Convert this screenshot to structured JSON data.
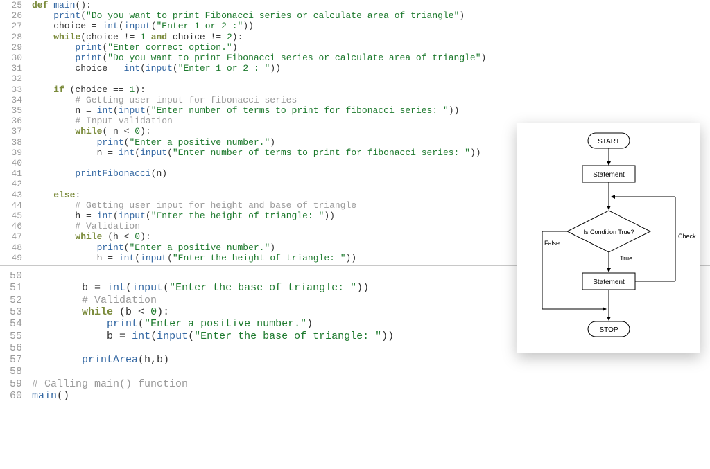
{
  "code": {
    "lines": [
      {
        "n": 25,
        "tokens": [
          [
            "kw",
            "def"
          ],
          [
            "norm",
            " "
          ],
          [
            "fn",
            "main"
          ],
          [
            "norm",
            "():"
          ]
        ]
      },
      {
        "n": 26,
        "tokens": [
          [
            "norm",
            "    "
          ],
          [
            "fn",
            "print"
          ],
          [
            "norm",
            "("
          ],
          [
            "str",
            "\"Do you want to print Fibonacci series or calculate area of triangle\""
          ],
          [
            "norm",
            ")"
          ]
        ]
      },
      {
        "n": 27,
        "tokens": [
          [
            "norm",
            "    choice "
          ],
          [
            "op",
            "="
          ],
          [
            "norm",
            " "
          ],
          [
            "fn",
            "int"
          ],
          [
            "norm",
            "("
          ],
          [
            "fn",
            "input"
          ],
          [
            "norm",
            "("
          ],
          [
            "str",
            "\"Enter 1 or 2 :\""
          ],
          [
            "norm",
            "))"
          ]
        ]
      },
      {
        "n": 28,
        "tokens": [
          [
            "norm",
            "    "
          ],
          [
            "kw",
            "while"
          ],
          [
            "norm",
            "(choice "
          ],
          [
            "op",
            "!="
          ],
          [
            "norm",
            " "
          ],
          [
            "num",
            "1"
          ],
          [
            "norm",
            " "
          ],
          [
            "kw",
            "and"
          ],
          [
            "norm",
            " choice "
          ],
          [
            "op",
            "!="
          ],
          [
            "norm",
            " "
          ],
          [
            "num",
            "2"
          ],
          [
            "norm",
            "):"
          ]
        ]
      },
      {
        "n": 29,
        "tokens": [
          [
            "norm",
            "        "
          ],
          [
            "fn",
            "print"
          ],
          [
            "norm",
            "("
          ],
          [
            "str",
            "\"Enter correct option.\""
          ],
          [
            "norm",
            ")"
          ]
        ]
      },
      {
        "n": 30,
        "tokens": [
          [
            "norm",
            "        "
          ],
          [
            "fn",
            "print"
          ],
          [
            "norm",
            "("
          ],
          [
            "str",
            "\"Do you want to print Fibonacci series or calculate area of triangle\""
          ],
          [
            "norm",
            ")"
          ]
        ]
      },
      {
        "n": 31,
        "tokens": [
          [
            "norm",
            "        choice "
          ],
          [
            "op",
            "="
          ],
          [
            "norm",
            " "
          ],
          [
            "fn",
            "int"
          ],
          [
            "norm",
            "("
          ],
          [
            "fn",
            "input"
          ],
          [
            "norm",
            "("
          ],
          [
            "str",
            "\"Enter 1 or 2 : \""
          ],
          [
            "norm",
            "))"
          ]
        ]
      },
      {
        "n": 32,
        "tokens": []
      },
      {
        "n": 33,
        "tokens": [
          [
            "norm",
            "    "
          ],
          [
            "kw",
            "if"
          ],
          [
            "norm",
            " (choice "
          ],
          [
            "op",
            "=="
          ],
          [
            "norm",
            " "
          ],
          [
            "num",
            "1"
          ],
          [
            "norm",
            "):"
          ]
        ]
      },
      {
        "n": 34,
        "tokens": [
          [
            "norm",
            "        "
          ],
          [
            "cmt",
            "# Getting user input for fibonacci series"
          ]
        ]
      },
      {
        "n": 35,
        "tokens": [
          [
            "norm",
            "        n "
          ],
          [
            "op",
            "="
          ],
          [
            "norm",
            " "
          ],
          [
            "fn",
            "int"
          ],
          [
            "norm",
            "("
          ],
          [
            "fn",
            "input"
          ],
          [
            "norm",
            "("
          ],
          [
            "str",
            "\"Enter number of terms to print for fibonacci series: \""
          ],
          [
            "norm",
            "))"
          ]
        ]
      },
      {
        "n": 36,
        "tokens": [
          [
            "norm",
            "        "
          ],
          [
            "cmt",
            "# Input validation"
          ]
        ]
      },
      {
        "n": 37,
        "tokens": [
          [
            "norm",
            "        "
          ],
          [
            "kw",
            "while"
          ],
          [
            "norm",
            "( n "
          ],
          [
            "op",
            "<"
          ],
          [
            "norm",
            " "
          ],
          [
            "num",
            "0"
          ],
          [
            "norm",
            "):"
          ]
        ]
      },
      {
        "n": 38,
        "tokens": [
          [
            "norm",
            "            "
          ],
          [
            "fn",
            "print"
          ],
          [
            "norm",
            "("
          ],
          [
            "str",
            "\"Enter a positive number.\""
          ],
          [
            "norm",
            ")"
          ]
        ]
      },
      {
        "n": 39,
        "tokens": [
          [
            "norm",
            "            n "
          ],
          [
            "op",
            "="
          ],
          [
            "norm",
            " "
          ],
          [
            "fn",
            "int"
          ],
          [
            "norm",
            "("
          ],
          [
            "fn",
            "input"
          ],
          [
            "norm",
            "("
          ],
          [
            "str",
            "\"Enter number of terms to print for fibonacci series: \""
          ],
          [
            "norm",
            "))"
          ]
        ]
      },
      {
        "n": 40,
        "tokens": []
      },
      {
        "n": 41,
        "tokens": [
          [
            "norm",
            "        "
          ],
          [
            "fn",
            "printFibonacci"
          ],
          [
            "norm",
            "(n)"
          ]
        ]
      },
      {
        "n": 42,
        "tokens": []
      },
      {
        "n": 43,
        "tokens": [
          [
            "norm",
            "    "
          ],
          [
            "kw",
            "else"
          ],
          [
            "norm",
            ":"
          ]
        ]
      },
      {
        "n": 44,
        "tokens": [
          [
            "norm",
            "        "
          ],
          [
            "cmt",
            "# Getting user input for height and base of triangle"
          ]
        ]
      },
      {
        "n": 45,
        "tokens": [
          [
            "norm",
            "        h "
          ],
          [
            "op",
            "="
          ],
          [
            "norm",
            " "
          ],
          [
            "fn",
            "int"
          ],
          [
            "norm",
            "("
          ],
          [
            "fn",
            "input"
          ],
          [
            "norm",
            "("
          ],
          [
            "str",
            "\"Enter the height of triangle: \""
          ],
          [
            "norm",
            "))"
          ]
        ]
      },
      {
        "n": 46,
        "tokens": [
          [
            "norm",
            "        "
          ],
          [
            "cmt",
            "# Validation"
          ]
        ]
      },
      {
        "n": 47,
        "tokens": [
          [
            "norm",
            "        "
          ],
          [
            "kw",
            "while"
          ],
          [
            "norm",
            " (h "
          ],
          [
            "op",
            "<"
          ],
          [
            "norm",
            " "
          ],
          [
            "num",
            "0"
          ],
          [
            "norm",
            "):"
          ]
        ]
      },
      {
        "n": 48,
        "tokens": [
          [
            "norm",
            "            "
          ],
          [
            "fn",
            "print"
          ],
          [
            "norm",
            "("
          ],
          [
            "str",
            "\"Enter a positive number.\""
          ],
          [
            "norm",
            ")"
          ]
        ]
      },
      {
        "n": 49,
        "tokens": [
          [
            "norm",
            "            h "
          ],
          [
            "op",
            "="
          ],
          [
            "norm",
            " "
          ],
          [
            "fn",
            "int"
          ],
          [
            "norm",
            "("
          ],
          [
            "fn",
            "input"
          ],
          [
            "norm",
            "("
          ],
          [
            "str",
            "\"Enter the height of triangle: \""
          ],
          [
            "norm",
            "))"
          ]
        ]
      }
    ],
    "lines2": [
      {
        "n": 50,
        "tokens": []
      },
      {
        "n": 51,
        "tokens": [
          [
            "norm",
            "        b "
          ],
          [
            "op",
            "="
          ],
          [
            "norm",
            " "
          ],
          [
            "fn",
            "int"
          ],
          [
            "norm",
            "("
          ],
          [
            "fn",
            "input"
          ],
          [
            "norm",
            "("
          ],
          [
            "str",
            "\"Enter the base of triangle: \""
          ],
          [
            "norm",
            "))"
          ]
        ]
      },
      {
        "n": 52,
        "tokens": [
          [
            "norm",
            "        "
          ],
          [
            "cmt",
            "# Validation"
          ]
        ]
      },
      {
        "n": 53,
        "tokens": [
          [
            "norm",
            "        "
          ],
          [
            "kw",
            "while"
          ],
          [
            "norm",
            " (b "
          ],
          [
            "op",
            "<"
          ],
          [
            "norm",
            " "
          ],
          [
            "num",
            "0"
          ],
          [
            "norm",
            "):"
          ]
        ]
      },
      {
        "n": 54,
        "tokens": [
          [
            "norm",
            "            "
          ],
          [
            "fn",
            "print"
          ],
          [
            "norm",
            "("
          ],
          [
            "str",
            "\"Enter a positive number.\""
          ],
          [
            "norm",
            ")"
          ]
        ]
      },
      {
        "n": 55,
        "tokens": [
          [
            "norm",
            "            b "
          ],
          [
            "op",
            "="
          ],
          [
            "norm",
            " "
          ],
          [
            "fn",
            "int"
          ],
          [
            "norm",
            "("
          ],
          [
            "fn",
            "input"
          ],
          [
            "norm",
            "("
          ],
          [
            "str",
            "\"Enter the base of triangle: \""
          ],
          [
            "norm",
            "))"
          ]
        ]
      },
      {
        "n": 56,
        "tokens": []
      },
      {
        "n": 57,
        "tokens": [
          [
            "norm",
            "        "
          ],
          [
            "fn",
            "printArea"
          ],
          [
            "norm",
            "(h,b)"
          ]
        ]
      },
      {
        "n": 58,
        "tokens": []
      },
      {
        "n": 59,
        "tokens": [
          [
            "cmt",
            "# Calling main() function"
          ]
        ]
      },
      {
        "n": 60,
        "tokens": [
          [
            "fn",
            "main"
          ],
          [
            "norm",
            "()"
          ]
        ]
      }
    ]
  },
  "flowchart": {
    "start": "START",
    "statement1": "Statement",
    "condition": "Is Condition True?",
    "true_label": "True",
    "false_label": "False",
    "check_again": "Check Again",
    "statement2": "Statement",
    "stop": "STOP"
  }
}
